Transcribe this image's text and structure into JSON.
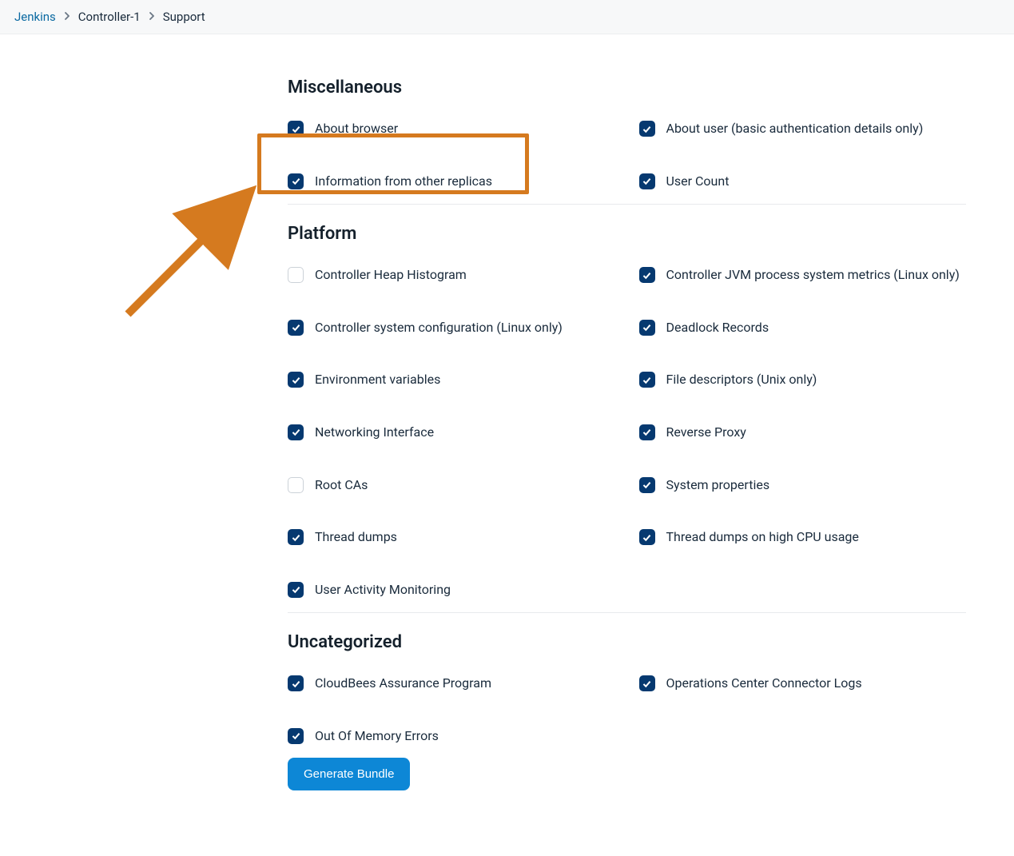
{
  "breadcrumb": {
    "items": [
      {
        "label": "Jenkins",
        "primary": true
      },
      {
        "label": "Controller-1",
        "primary": false
      },
      {
        "label": "Support",
        "primary": false
      }
    ]
  },
  "sections": {
    "misc": {
      "title": "Miscellaneous",
      "items": [
        {
          "id": "about-browser",
          "label": "About browser",
          "checked": true
        },
        {
          "id": "about-user",
          "label": "About user (basic authentication details only)",
          "checked": true
        },
        {
          "id": "info-other-replicas",
          "label": "Information from other replicas",
          "checked": true,
          "highlight": true
        },
        {
          "id": "user-count",
          "label": "User Count",
          "checked": true
        }
      ]
    },
    "platform": {
      "title": "Platform",
      "items": [
        {
          "id": "controller-heap-histogram",
          "label": "Controller Heap Histogram",
          "checked": false
        },
        {
          "id": "controller-jvm-metrics",
          "label": "Controller JVM process system metrics (Linux only)",
          "checked": true
        },
        {
          "id": "controller-sys-config",
          "label": "Controller system configuration (Linux only)",
          "checked": true
        },
        {
          "id": "deadlock-records",
          "label": "Deadlock Records",
          "checked": true
        },
        {
          "id": "env-vars",
          "label": "Environment variables",
          "checked": true
        },
        {
          "id": "file-descriptors",
          "label": "File descriptors (Unix only)",
          "checked": true
        },
        {
          "id": "networking-interface",
          "label": "Networking Interface",
          "checked": true
        },
        {
          "id": "reverse-proxy",
          "label": "Reverse Proxy",
          "checked": true
        },
        {
          "id": "root-cas",
          "label": "Root CAs",
          "checked": false
        },
        {
          "id": "system-properties",
          "label": "System properties",
          "checked": true
        },
        {
          "id": "thread-dumps",
          "label": "Thread dumps",
          "checked": true
        },
        {
          "id": "thread-dumps-high-cpu",
          "label": "Thread dumps on high CPU usage",
          "checked": true
        },
        {
          "id": "user-activity-monitoring",
          "label": "User Activity Monitoring",
          "checked": true
        }
      ]
    },
    "uncategorized": {
      "title": "Uncategorized",
      "items": [
        {
          "id": "cloudbees-assurance",
          "label": "CloudBees Assurance Program",
          "checked": true
        },
        {
          "id": "oc-connector-logs",
          "label": "Operations Center Connector Logs",
          "checked": true
        },
        {
          "id": "oom-errors",
          "label": "Out Of Memory Errors",
          "checked": true
        }
      ]
    }
  },
  "actions": {
    "generate_bundle_label": "Generate Bundle"
  },
  "annotation": {
    "highlight_color": "#d57a1f"
  }
}
